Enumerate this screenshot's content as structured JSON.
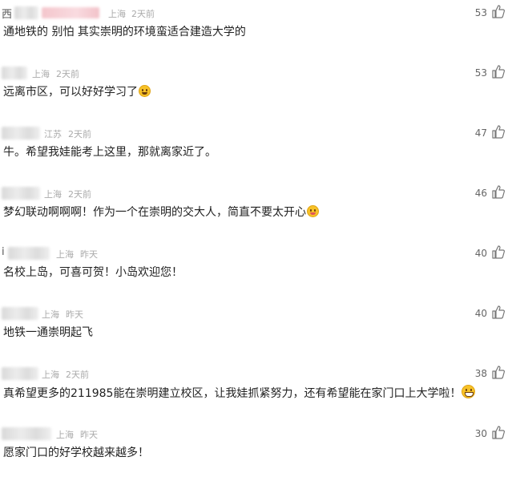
{
  "comments": [
    {
      "name": "西",
      "location": "上海",
      "time": "2天前",
      "text": "通地铁的 别怕 其实崇明的环境蛮适合建造大学的",
      "likes": "53",
      "emoji": ""
    },
    {
      "name": "",
      "location": "上海",
      "time": "2天前",
      "text": "远离市区，可以好好学习了",
      "likes": "53",
      "emoji": "grin-sweat-icon"
    },
    {
      "name": "",
      "location": "江苏",
      "time": "2天前",
      "text": "牛。希望我娃能考上这里，那就离家近了。",
      "likes": "47",
      "emoji": ""
    },
    {
      "name": "",
      "location": "上海",
      "time": "2天前",
      "text": "梦幻联动啊啊啊！作为一个在崇明的交大人，简直不要太开心",
      "likes": "46",
      "emoji": "tongue-wink-icon"
    },
    {
      "name": "i",
      "location": "上海",
      "time": "昨天",
      "text": "名校上岛，可喜可贺！小岛欢迎您！",
      "likes": "40",
      "emoji": ""
    },
    {
      "name": "",
      "location": "上海",
      "time": "昨天",
      "text": "地铁一通崇明起飞",
      "likes": "40",
      "emoji": ""
    },
    {
      "name": "",
      "location": "上海",
      "time": "2天前",
      "text": "真希望更多的211985能在崇明建立校区，让我娃抓紧努力，还有希望能在家门口上大学啦！",
      "likes": "38",
      "emoji": "grimace-icon"
    },
    {
      "name": "",
      "location": "上海",
      "time": "昨天",
      "text": "愿家门口的好学校越来越多！",
      "likes": "30",
      "emoji": ""
    }
  ],
  "icons": {
    "like": "thumbs-up-icon"
  },
  "colors": {
    "meta": "#aaaaaa",
    "text": "#222222",
    "count": "#666666"
  }
}
